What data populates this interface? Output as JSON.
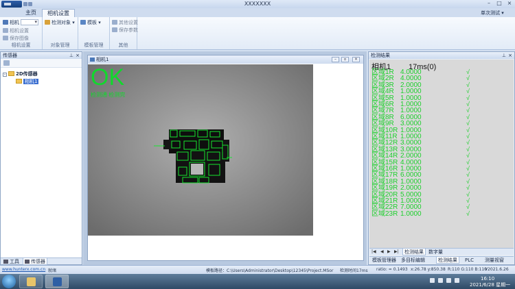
{
  "window": {
    "title": "XXXXXXX",
    "help_label": "单次测试 ▾"
  },
  "ribbon": {
    "tabs": [
      "主页",
      "相机设置"
    ],
    "active_tab": 1,
    "groups": [
      {
        "label": "相机设置",
        "items": [
          "相机",
          "相机设置",
          "保存图像"
        ]
      },
      {
        "label": "对象管理",
        "items": [
          "检测对象 ▾"
        ]
      },
      {
        "label": "模板管理",
        "items": [
          "模板 ▾"
        ]
      },
      {
        "label": "其他",
        "items": [
          "其他设置",
          "保存参数"
        ]
      }
    ]
  },
  "sensor_panel": {
    "title": "传感器",
    "tree_root": "2D传感器",
    "tree_child": "相机1",
    "tabs": [
      "工具",
      "传感器"
    ]
  },
  "camera_window": {
    "title": "相机1",
    "ok_text": "OK",
    "ok_subtext": "检测通 检测完"
  },
  "results_panel": {
    "title": "检测结果",
    "camera": "相机1",
    "time": "17ms(0)",
    "rows": [
      {
        "name": "区域1R",
        "value": "4.0000",
        "check": "√"
      },
      {
        "name": "区域2R",
        "value": "4.0000",
        "check": "√"
      },
      {
        "name": "区域3R",
        "value": "2.0000",
        "check": "√"
      },
      {
        "name": "区域4R",
        "value": "1.0000",
        "check": "√"
      },
      {
        "name": "区域5R",
        "value": "1.0000",
        "check": "√"
      },
      {
        "name": "区域6R",
        "value": "1.0000",
        "check": "√"
      },
      {
        "name": "区域7R",
        "value": "1.0000",
        "check": "√"
      },
      {
        "name": "区域8R",
        "value": "6.0000",
        "check": "√"
      },
      {
        "name": "区域9R",
        "value": "3.0000",
        "check": "√"
      },
      {
        "name": "区域10R",
        "value": "1.0000",
        "check": "√"
      },
      {
        "name": "区域11R",
        "value": "1.0000",
        "check": "√"
      },
      {
        "name": "区域12R",
        "value": "3.0000",
        "check": "√"
      },
      {
        "name": "区域13R",
        "value": "3.0000",
        "check": "√"
      },
      {
        "name": "区域14R",
        "value": "2.0000",
        "check": "√"
      },
      {
        "name": "区域15R",
        "value": "4.0000",
        "check": "√"
      },
      {
        "name": "区域16R",
        "value": "1.0000",
        "check": "√"
      },
      {
        "name": "区域17R",
        "value": "6.0000",
        "check": "√"
      },
      {
        "name": "区域18R",
        "value": "1.0000",
        "check": "√"
      },
      {
        "name": "区域19R",
        "value": "2.0000",
        "check": "√"
      },
      {
        "name": "区域20R",
        "value": "5.0000",
        "check": "√"
      },
      {
        "name": "区域21R",
        "value": "1.0000",
        "check": "√"
      },
      {
        "name": "区域22R",
        "value": "7.0000",
        "check": "√"
      },
      {
        "name": "区域23R",
        "value": "1.0000",
        "check": "√"
      }
    ],
    "inner_tabs": [
      "检测结果",
      "数字量"
    ],
    "bottom_tabs": [
      "模板管理器",
      "多目标编辑",
      "检测结果",
      "PLC",
      "测量视窗"
    ]
  },
  "status_bar": {
    "url": "www.hunterx.com.cn",
    "state": "就绪",
    "template_path": "模板路径：C:\\Users\\Administrator\\Desktop\\12345\\Project.MSor",
    "detect_time": "检测时间17ms",
    "ratio": "ratio: = 0.1493",
    "coords": "x:26.78 y:850.38",
    "rgb": "R:110 G:110 B:110",
    "version": "V2021.6.26"
  },
  "taskbar": {
    "time": "16:10",
    "date": "2021/6/28 星期一"
  },
  "colors": {
    "ok_green": "#10d92c",
    "result_green": "#1ccf2c",
    "panel_bg": "#d9d9d9"
  }
}
